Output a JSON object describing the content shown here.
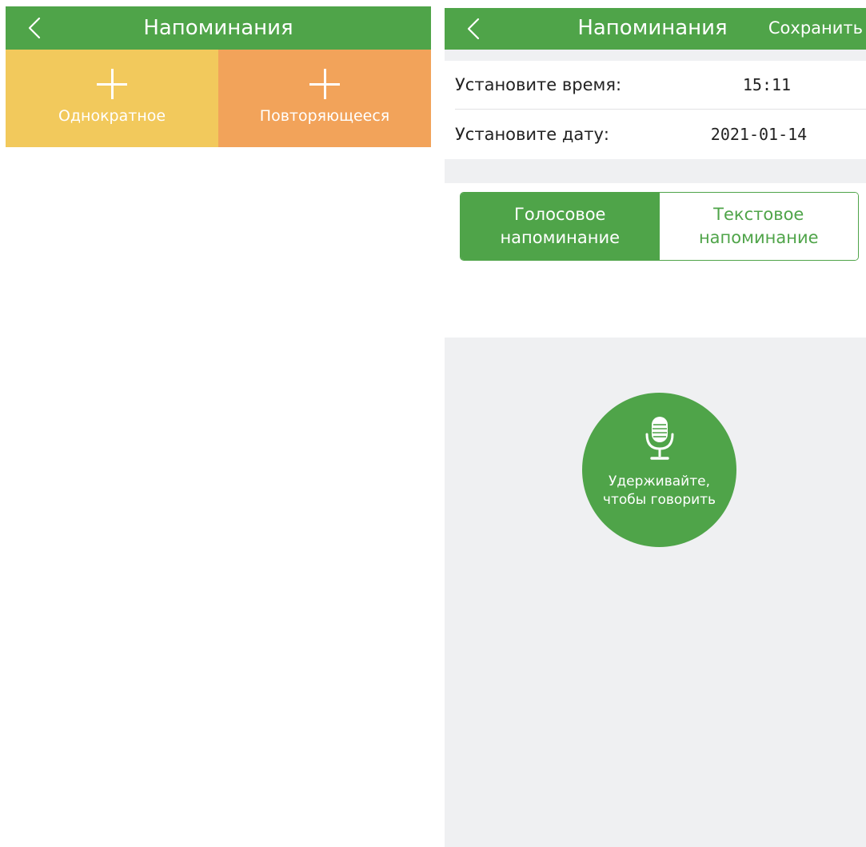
{
  "left_screen": {
    "header": {
      "title": "Напоминания",
      "back_icon": "chevron-left-icon"
    },
    "add_options": [
      {
        "label": "Однократное",
        "icon": "plus-icon",
        "color": "#f2c95c"
      },
      {
        "label": "Повторяющееся",
        "icon": "plus-icon",
        "color": "#f2a35a"
      }
    ]
  },
  "right_screen": {
    "header": {
      "title": "Напоминания",
      "save_label": "Сохранить",
      "back_icon": "chevron-left-icon"
    },
    "settings": {
      "time_label": "Установите время:",
      "time_value": "15:11",
      "date_label": "Установите дату:",
      "date_value": "2021-01-14"
    },
    "mode_tabs": [
      {
        "label": "Голосовое напоминание",
        "selected": true
      },
      {
        "label": "Текстовое напоминание",
        "selected": false
      }
    ],
    "talk_button": {
      "label": "Удерживайте,\nчтобы говорить",
      "icon": "microphone-icon"
    }
  },
  "colors": {
    "accent_green": "#4fa449",
    "tile_yellow": "#f2c95c",
    "tile_orange": "#f2a35a",
    "background_gray": "#eff0f2"
  }
}
